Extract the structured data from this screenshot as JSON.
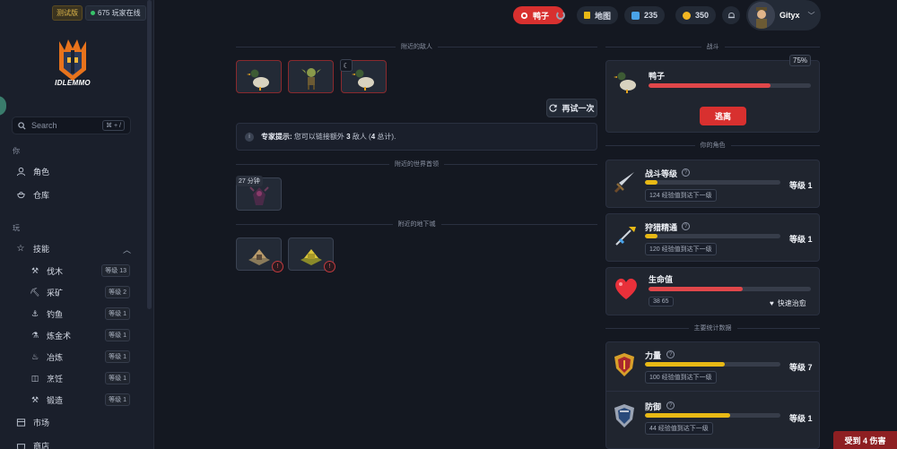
{
  "sidebar": {
    "badge_test": "测试版",
    "online": "675 玩家在线",
    "logo_text": "IDLEMMO",
    "search_placeholder": "Search",
    "search_shortcut": "⌘ + /",
    "section_you": "你",
    "nav_character": "角色",
    "nav_inventory": "仓库",
    "section_play": "玩",
    "nav_skills": "技能",
    "skills": [
      {
        "label": "伐木",
        "level": "等级 13",
        "icon": "axe-icon"
      },
      {
        "label": "采矿",
        "level": "等级 2",
        "icon": "pickaxe-icon"
      },
      {
        "label": "钓鱼",
        "level": "等级 1",
        "icon": "fishing-hook-icon"
      },
      {
        "label": "炼金术",
        "level": "等级 1",
        "icon": "flask-icon"
      },
      {
        "label": "冶炼",
        "level": "等级 1",
        "icon": "fire-icon"
      },
      {
        "label": "烹饪",
        "level": "等级 1",
        "icon": "pot-icon"
      },
      {
        "label": "锻造",
        "level": "等级 1",
        "icon": "hammer-icon"
      }
    ],
    "nav_market": "市场",
    "nav_shop": "商店"
  },
  "topbar": {
    "duck_label": "鸭子",
    "map_label": "地图",
    "gems": "235",
    "coins": "350",
    "username": "Gityx"
  },
  "battle": {
    "section_enemies": "附近的敌人",
    "section_bosses": "附近的世界首领",
    "section_dungeons": "附近的地下城",
    "retry_label": "再试一次",
    "tip_prefix": "专家提示:",
    "tip_text_1": "您可以链接额外",
    "tip_num_1": "3",
    "tip_text_2": "敌人 (",
    "tip_num_2": "4",
    "tip_text_3": "总计).",
    "boss_timer": "27 分钟",
    "enemies": [
      "duck",
      "goblin",
      "duck"
    ]
  },
  "combat": {
    "section_battle": "战斗",
    "enemy_name": "鸭子",
    "enemy_hp_fraction": 0.75,
    "enemy_hp_pct": "75%",
    "flee_label": "逃离",
    "section_character": "你的角色",
    "combat_skill": {
      "label": "战斗等级",
      "xp": "124 经验值到达下一级",
      "level": "等级 1",
      "fraction": 0.09
    },
    "hunt_skill": {
      "label": "狩猎精通",
      "xp": "120 经验值到达下一级",
      "level": "等级 1",
      "fraction": 0.09
    },
    "health": {
      "label": "生命值",
      "value": "38  65",
      "fraction": 0.58,
      "heal_label": "快速治愈"
    },
    "section_stats": "主要统计数据",
    "strength": {
      "label": "力量",
      "xp": "100 经验值到达下一级",
      "level": "等级 7",
      "fraction": 0.59
    },
    "defence": {
      "label": "防御",
      "xp": "44 经验值到达下一级",
      "level": "等级 1",
      "fraction": 0.63
    }
  },
  "toast": "受到 4 伤害",
  "colors": {
    "accent_red": "#d8302f",
    "bar_yellow": "#e8b915",
    "bar_red": "#e0474a"
  }
}
